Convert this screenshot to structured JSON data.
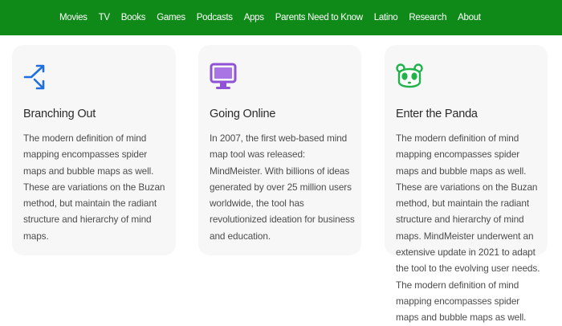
{
  "nav": {
    "items": [
      "Movies",
      "TV",
      "Books",
      "Games",
      "Podcasts",
      "Apps",
      "Parents Need to Know",
      "Latino",
      "Research",
      "About"
    ]
  },
  "cards": [
    {
      "icon": "branching-arrows-icon",
      "title": "Branching Out",
      "body": "The modern definition of mind mapping encompasses spider maps and bubble maps as well. These are variations on the Buzan method, but maintain the radiant structure and hierarchy of mind maps."
    },
    {
      "icon": "monitor-icon",
      "title": "Going Online",
      "body": "In 2007, the first web-based mind map tool was released: MindMeister. With billions of ideas generated by over 25 million users worldwide, the tool has revolutionized ideation for business and education."
    },
    {
      "icon": "panda-icon",
      "title": "Enter the Panda",
      "body": "The modern definition of mind mapping encompasses spider maps and bubble maps as well. These are variations on the Buzan method, but maintain the radiant structure and hierarchy of mind maps. MindMeister underwent an extensive update in 2021 to adapt the tool to the evolving user needs. The modern definition of mind mapping encompasses spider maps and bubble maps as well."
    }
  ],
  "colors": {
    "nav_bg": "#0f8a18",
    "card_bg": "#f7f7f7",
    "icon_blue": "#1f6fe0",
    "icon_purple": "#8f52d6",
    "icon_green": "#1fb34a"
  }
}
